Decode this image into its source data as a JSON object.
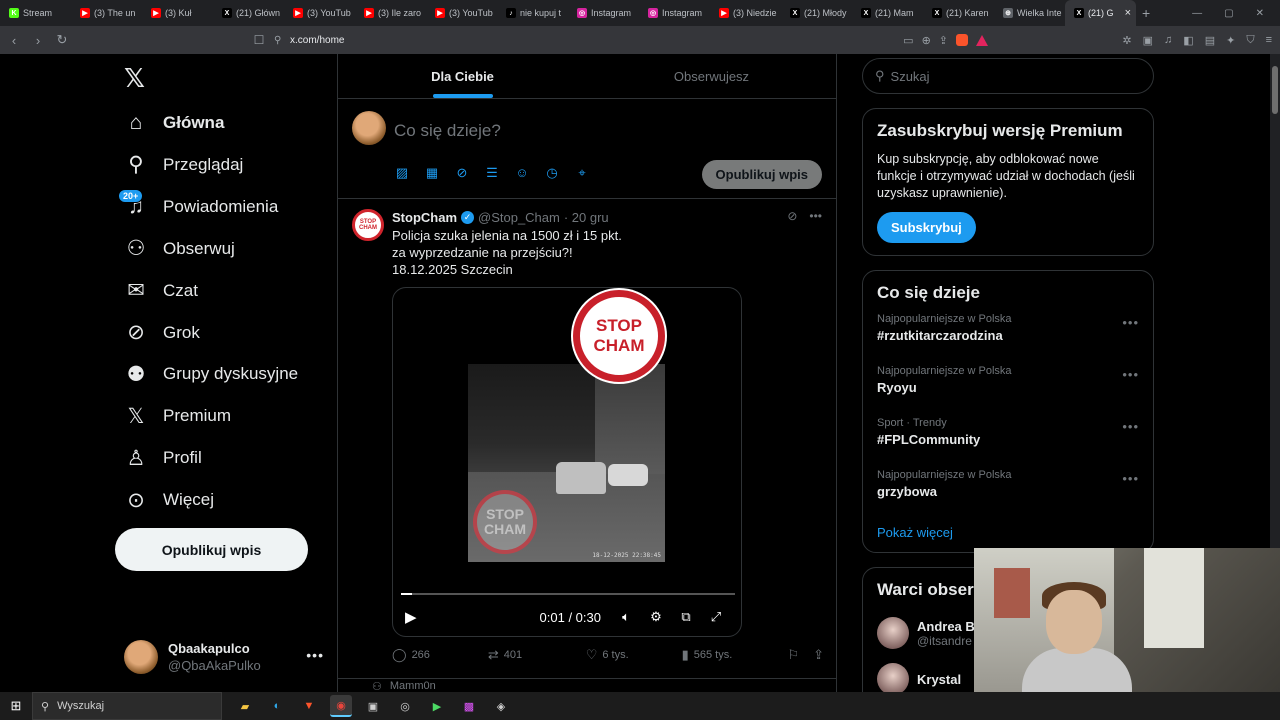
{
  "browser": {
    "tabs": [
      {
        "label": "Stream",
        "fav_color": "#53fc18",
        "fav_text": "K"
      },
      {
        "label": "(3) The un",
        "fav_color": "#ff0000",
        "fav_text": "▶"
      },
      {
        "label": "(3) Kuł",
        "fav_color": "#ff0000",
        "fav_text": "▶"
      },
      {
        "label": "(21) Główn",
        "fav_color": "#000000",
        "fav_text": "X"
      },
      {
        "label": "(3) YouTub",
        "fav_color": "#ff0000",
        "fav_text": "▶"
      },
      {
        "label": "(3) Ile zaro",
        "fav_color": "#ff0000",
        "fav_text": "▶"
      },
      {
        "label": "(3) YouTub",
        "fav_color": "#ff0000",
        "fav_text": "▶"
      },
      {
        "label": "nie kupuj t",
        "fav_color": "#000000",
        "fav_text": "♪"
      },
      {
        "label": "Instagram",
        "fav_color": "#d6249f",
        "fav_text": "◎"
      },
      {
        "label": "Instagram",
        "fav_color": "#d6249f",
        "fav_text": "◎"
      },
      {
        "label": "(3) Niedzie",
        "fav_color": "#ff0000",
        "fav_text": "▶"
      },
      {
        "label": "(21) Młody",
        "fav_color": "#000000",
        "fav_text": "X"
      },
      {
        "label": "(21) Mam",
        "fav_color": "#000000",
        "fav_text": "X"
      },
      {
        "label": "(21) Karen",
        "fav_color": "#000000",
        "fav_text": "X"
      },
      {
        "label": "Wielka Inte",
        "fav_color": "#5f6368",
        "fav_text": "⊕"
      },
      {
        "label": "(21) G",
        "fav_color": "#000000",
        "fav_text": "X",
        "active": true
      }
    ],
    "url": "x.com/home"
  },
  "nav": {
    "items": [
      {
        "label": "Główna",
        "icon": "home-icon",
        "bold": true
      },
      {
        "label": "Przeglądaj",
        "icon": "search-icon"
      },
      {
        "label": "Powiadomienia",
        "icon": "bell-icon",
        "badge": "20+"
      },
      {
        "label": "Obserwuj",
        "icon": "follow-icon"
      },
      {
        "label": "Czat",
        "icon": "mail-icon"
      },
      {
        "label": "Grok",
        "icon": "grok-icon"
      },
      {
        "label": "Grupy dyskusyjne",
        "icon": "communities-icon"
      },
      {
        "label": "Premium",
        "icon": "x-premium-icon"
      },
      {
        "label": "Profil",
        "icon": "profile-icon"
      },
      {
        "label": "Więcej",
        "icon": "more-icon"
      }
    ],
    "post_button": "Opublikuj wpis",
    "account": {
      "name": "Qbaakapulco",
      "handle": "@QbaAkaPulko"
    }
  },
  "feed": {
    "tabs": [
      "Dla Ciebie",
      "Obserwujesz"
    ],
    "compose": {
      "placeholder": "Co się dzieje?",
      "publish": "Opublikuj wpis"
    },
    "tweet": {
      "author": "StopCham",
      "handle": "@Stop_Cham",
      "time": "· 20 gru",
      "lines": [
        "Policja szuka jelenia na 1500 zł i 15 pkt.",
        "za wyprzedzanie na przejściu?!",
        "18.12.2025 Szczecin"
      ],
      "avatar_text": "STOP CHAM",
      "video": {
        "logo_line1": "STOP",
        "logo_line2": "CHAM",
        "time": "0:01 / 0:30",
        "progress": 0.033,
        "timestamp": "18-12-2025 22:38:45"
      },
      "stats": {
        "replies": "266",
        "reposts": "401",
        "likes": "6 tys.",
        "views": "565 tys."
      }
    },
    "next_author": "Mamm0n"
  },
  "sidebar": {
    "search_placeholder": "Szukaj",
    "premium": {
      "title": "Zasubskrybuj wersję Premium",
      "text": "Kup subskrypcję, aby odblokować nowe funkcje i otrzymywać udział w dochodach (jeśli uzyskasz uprawnienie).",
      "button": "Subskrybuj"
    },
    "trends": {
      "title": "Co się dzieje",
      "items": [
        {
          "meta": "Najpopularniejsze w Polska",
          "name": "#rzutkitarczarodzina"
        },
        {
          "meta": "Najpopularniejsze w Polska",
          "name": "Ryoyu"
        },
        {
          "meta": "Sport · Trendy",
          "name": "#FPLCommunity"
        },
        {
          "meta": "Najpopularniejsze w Polska",
          "name": "grzybowa"
        }
      ],
      "show_more": "Pokaż więcej"
    },
    "who": {
      "title": "Warci obser",
      "items": [
        {
          "name": "Andrea Bo",
          "handle": "@itsandre"
        },
        {
          "name": "Krystal",
          "handle": ""
        }
      ]
    }
  },
  "taskbar": {
    "search": "Wyszukaj"
  }
}
